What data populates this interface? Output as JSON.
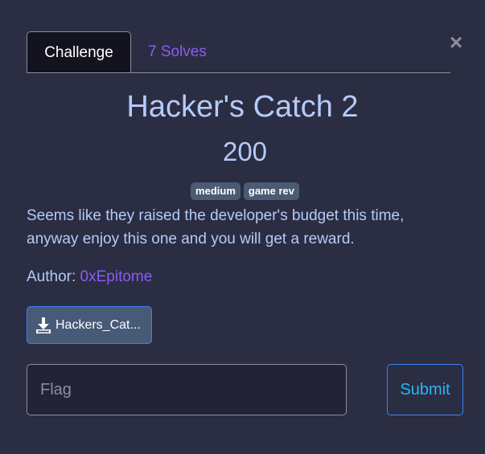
{
  "close_icon": "×",
  "tabs": [
    {
      "label": "Challenge",
      "active": true
    },
    {
      "label": "7 Solves",
      "active": false
    }
  ],
  "challenge": {
    "title": "Hacker's Catch 2",
    "points": "200",
    "tags": [
      "medium",
      "game rev"
    ],
    "description_lines": [
      "Seems like they raised the developer's budget this time,",
      "anyway enjoy this one and you will get a reward."
    ],
    "author_label": "Author:",
    "author_name": "0xEpitome",
    "file": {
      "name": "Hackers_Cat...",
      "icon": "download-icon"
    }
  },
  "form": {
    "flag_placeholder": "Flag",
    "flag_value": "",
    "submit_label": "Submit"
  },
  "colors": {
    "background": "#2b2d42",
    "text": "#b4cbf8",
    "link": "#8b5cf6",
    "tag_bg": "#4b5b75",
    "button_border": "#3b82f6",
    "submit_text": "#29b6f6"
  }
}
